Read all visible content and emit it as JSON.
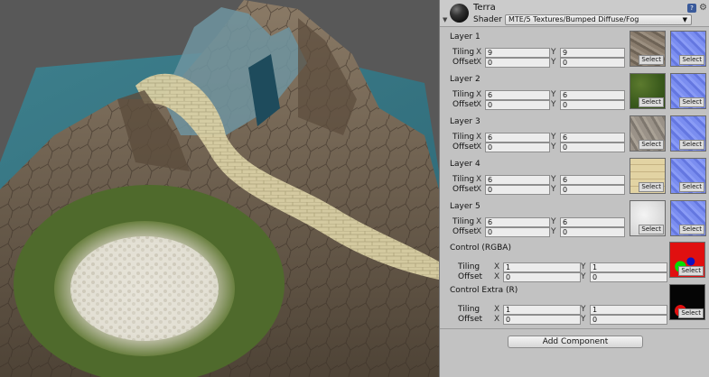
{
  "material": {
    "name": "Terra",
    "shader_label": "Shader",
    "shader_value": "MTE/5 Textures/Bumped Diffuse/Fog"
  },
  "icons": {
    "help": "help-icon",
    "gear": "gear-icon",
    "fold": "foldout-arrow-icon",
    "caret": "dropdown-caret-icon"
  },
  "labels": {
    "tiling": "Tiling",
    "offset": "Offset",
    "x": "X",
    "y": "Y",
    "select": "Select"
  },
  "layers": [
    {
      "title": "Layer 1",
      "tiling_x": "9",
      "tiling_y": "9",
      "offset_x": "0",
      "offset_y": "0"
    },
    {
      "title": "Layer 2",
      "tiling_x": "6",
      "tiling_y": "6",
      "offset_x": "0",
      "offset_y": "0"
    },
    {
      "title": "Layer 3",
      "tiling_x": "6",
      "tiling_y": "6",
      "offset_x": "0",
      "offset_y": "0"
    },
    {
      "title": "Layer 4",
      "tiling_x": "6",
      "tiling_y": "6",
      "offset_x": "0",
      "offset_y": "0"
    },
    {
      "title": "Layer 5",
      "tiling_x": "6",
      "tiling_y": "6",
      "offset_x": "0",
      "offset_y": "0"
    }
  ],
  "controls": [
    {
      "title": "Control (RGBA)",
      "tiling_x": "1",
      "tiling_y": "1",
      "offset_x": "0",
      "offset_y": "0"
    },
    {
      "title": "Control Extra (R)",
      "tiling_x": "1",
      "tiling_y": "1",
      "offset_x": "0",
      "offset_y": "0"
    }
  ],
  "add_component": "Add Component",
  "colors": {
    "inspector_bg": "#c2c2c2",
    "field_bg": "#ececec",
    "normal_map": "#6a7fe0",
    "control_red": "#e01010"
  }
}
